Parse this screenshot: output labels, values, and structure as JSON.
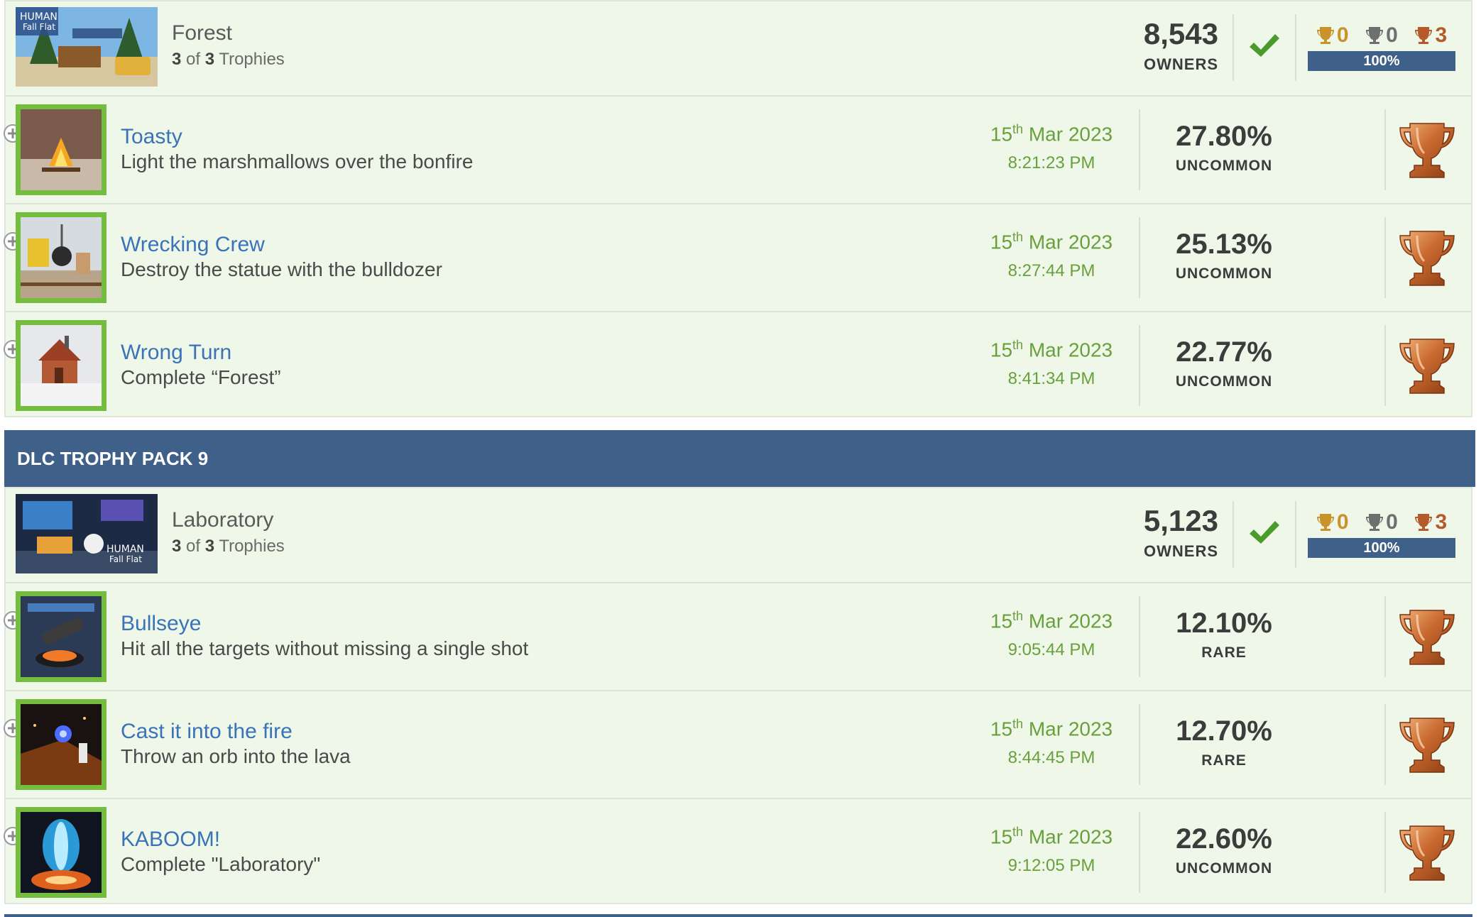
{
  "colors": {
    "accent": "#3f6089",
    "green": "#74bd3e",
    "date": "#69a03d",
    "link": "#3a73b8",
    "gold": "#c9922b",
    "silver": "#6f6f6f",
    "bronze": "#b45a2b"
  },
  "groups": [
    {
      "header": null,
      "game": {
        "name": "Forest",
        "earned": "3",
        "total": "3",
        "of": "of",
        "trophies_word": "Trophies",
        "owners": "8,543",
        "owners_label": "OWNERS",
        "gold": "0",
        "silver": "0",
        "bronze": "3",
        "progress": "100%",
        "progress_value": 100,
        "thumb_icon": "forest-level-art"
      },
      "trophies": [
        {
          "name": "Toasty",
          "desc": "Light the marshmallows over the bonfire",
          "day": "15",
          "ord": "th",
          "month_year": "Mar 2023",
          "time": "8:21:23 PM",
          "percent": "27.80%",
          "rarity": "UNCOMMON",
          "type": "bronze",
          "icon": "campfire-thumb"
        },
        {
          "name": "Wrecking Crew",
          "desc": "Destroy the statue with the bulldozer",
          "day": "15",
          "ord": "th",
          "month_year": "Mar 2023",
          "time": "8:27:44 PM",
          "percent": "25.13%",
          "rarity": "UNCOMMON",
          "type": "bronze",
          "icon": "bulldozer-thumb"
        },
        {
          "name": "Wrong Turn",
          "desc": "Complete “Forest”",
          "day": "15",
          "ord": "th",
          "month_year": "Mar 2023",
          "time": "8:41:34 PM",
          "percent": "22.77%",
          "rarity": "UNCOMMON",
          "type": "bronze",
          "icon": "cabin-thumb"
        }
      ]
    },
    {
      "header": "DLC TROPHY PACK 9",
      "game": {
        "name": "Laboratory",
        "earned": "3",
        "total": "3",
        "of": "of",
        "trophies_word": "Trophies",
        "owners": "5,123",
        "owners_label": "OWNERS",
        "gold": "0",
        "silver": "0",
        "bronze": "3",
        "progress": "100%",
        "progress_value": 100,
        "thumb_icon": "laboratory-level-art"
      },
      "trophies": [
        {
          "name": "Bullseye",
          "desc": "Hit all the targets without missing a single shot",
          "day": "15",
          "ord": "th",
          "month_year": "Mar 2023",
          "time": "9:05:44 PM",
          "percent": "12.10%",
          "rarity": "RARE",
          "type": "bronze",
          "icon": "cannon-thumb"
        },
        {
          "name": "Cast it into the fire",
          "desc": "Throw an orb into the lava",
          "day": "15",
          "ord": "th",
          "month_year": "Mar 2023",
          "time": "8:44:45 PM",
          "percent": "12.70%",
          "rarity": "RARE",
          "type": "bronze",
          "icon": "orb-thumb"
        },
        {
          "name": "KABOOM!",
          "desc": "Complete \"Laboratory\"",
          "day": "15",
          "ord": "th",
          "month_year": "Mar 2023",
          "time": "9:12:05 PM",
          "percent": "22.60%",
          "rarity": "UNCOMMON",
          "type": "bronze",
          "icon": "capsule-thumb"
        }
      ]
    }
  ]
}
